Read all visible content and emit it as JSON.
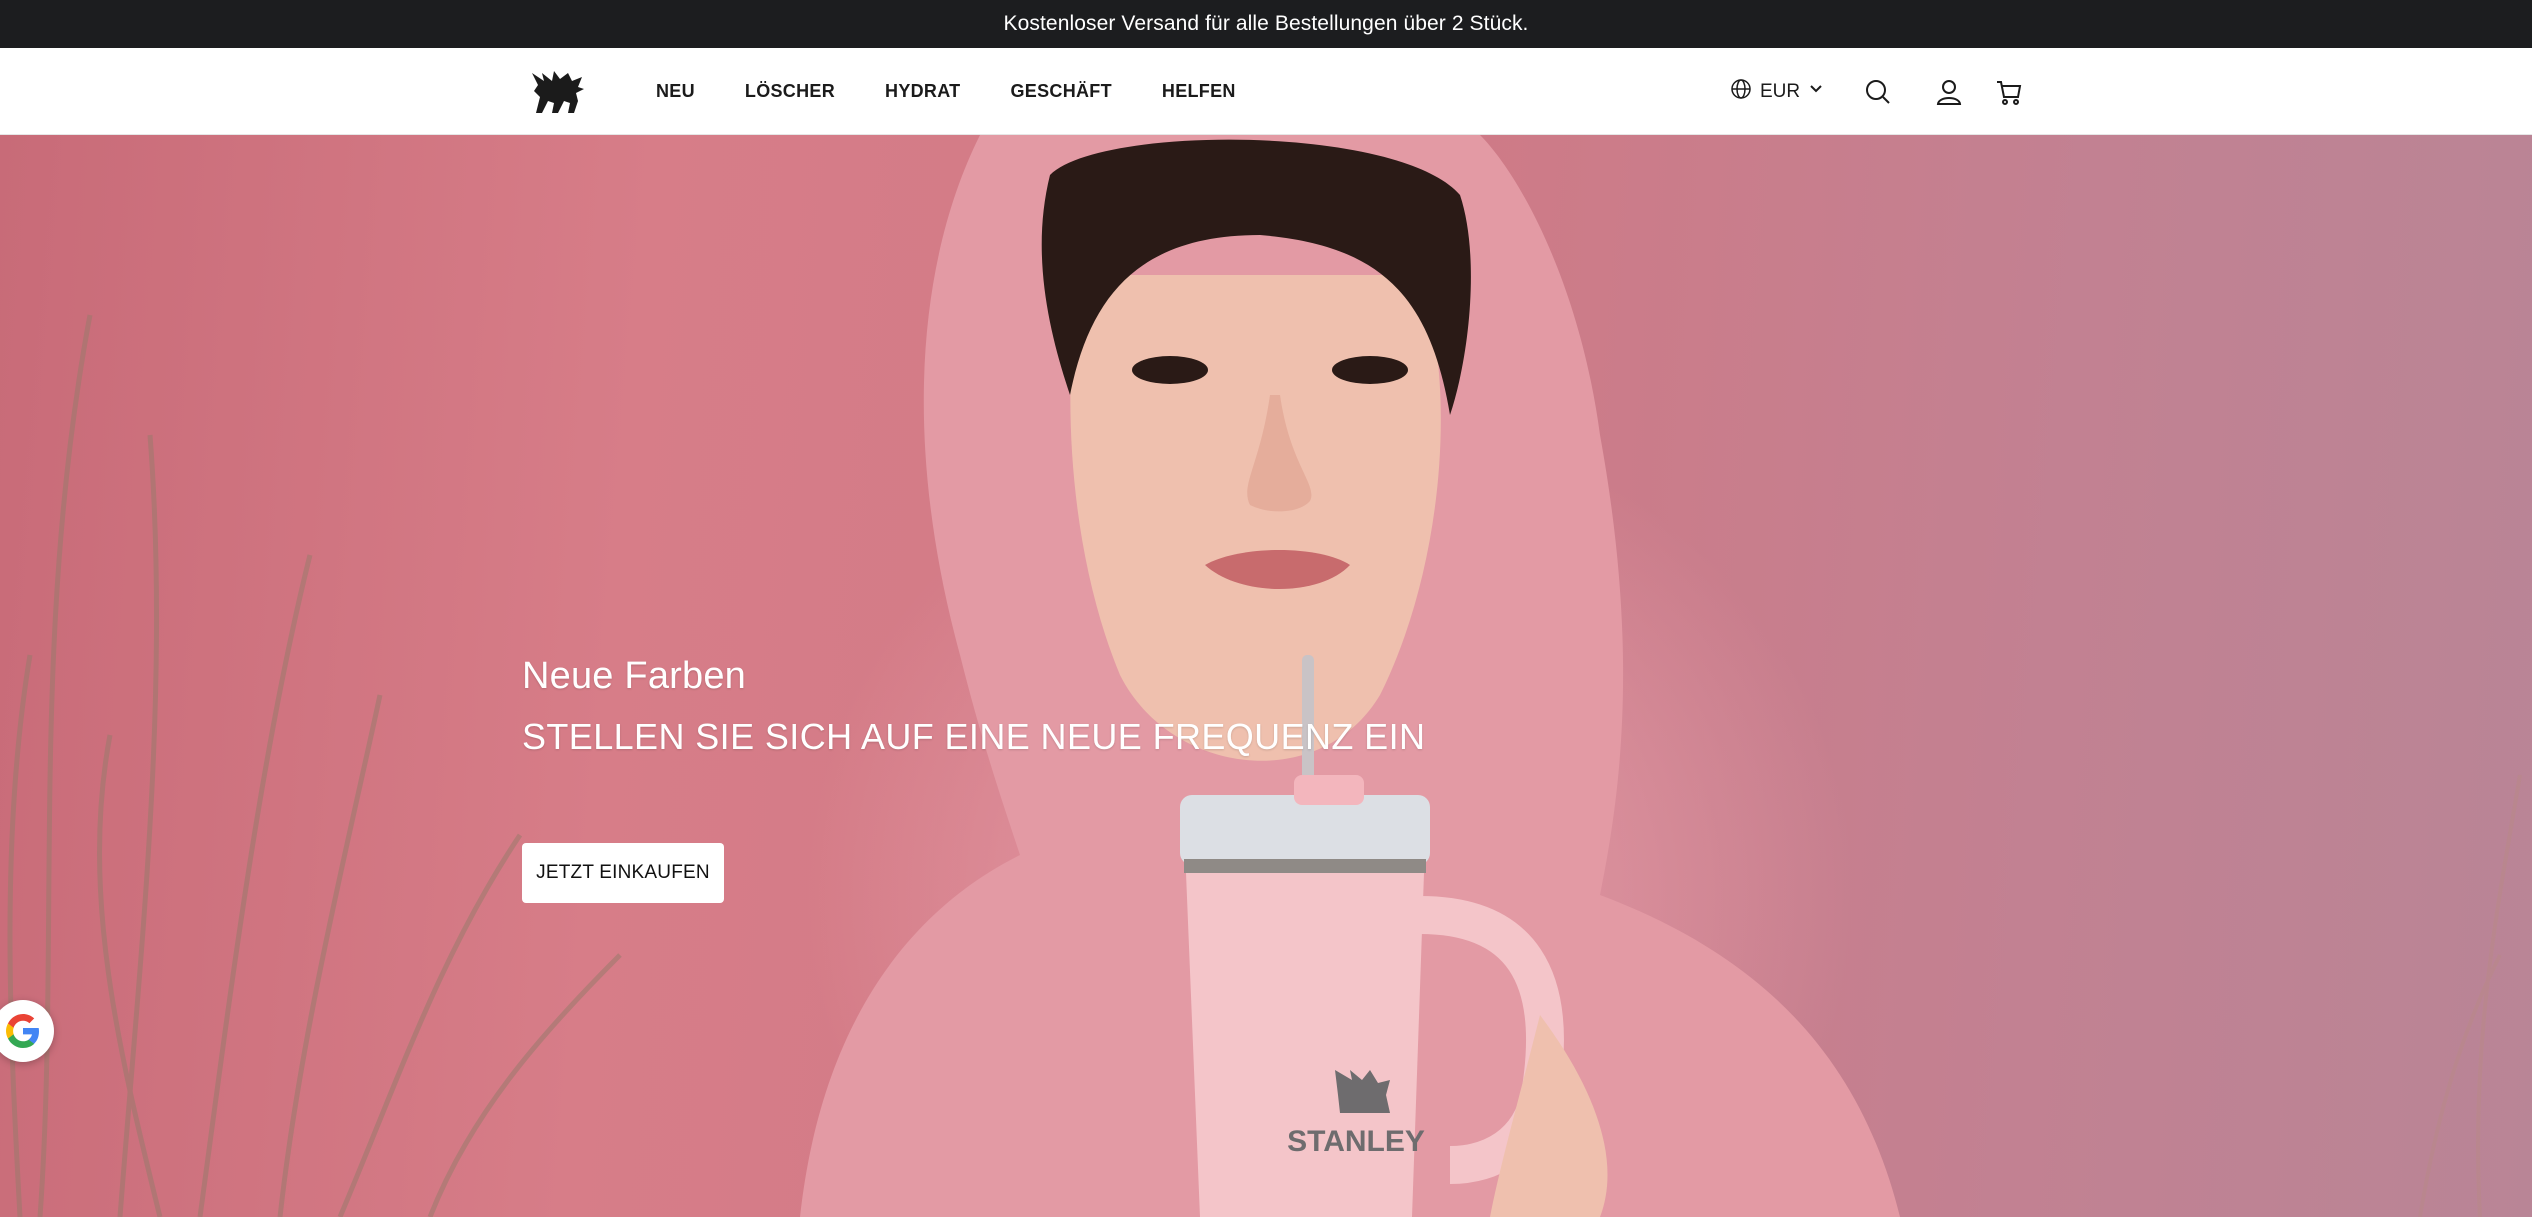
{
  "announcement": {
    "text": "Kostenloser Versand für alle Bestellungen über 2 Stück."
  },
  "header": {
    "logo_icon": "bear-with-wings-logo-icon",
    "nav": [
      {
        "label": "NEU"
      },
      {
        "label": "LÖSCHER"
      },
      {
        "label": "HYDRAT"
      },
      {
        "label": "GESCHÄFT"
      },
      {
        "label": "HELFEN"
      }
    ],
    "currency": {
      "label": "EUR",
      "icon": "globe-icon",
      "dropdown_icon": "chevron-down-icon"
    },
    "icons": [
      "search-icon",
      "account-icon",
      "cart-icon"
    ]
  },
  "hero": {
    "eyebrow": "Neue Farben",
    "title": "STELLEN SIE SICH AUF EINE NEUE FREQUENZ EIN",
    "cta_label": "JETZT EINKAUFEN",
    "product_brand_text": "STANLEY",
    "colors": {
      "background_pink": "#d77d88",
      "hoodie_pink": "#e9a2ad",
      "tumbler": "#f6c6c8"
    }
  },
  "floating": {
    "google_badge_icon": "google-g-icon"
  }
}
